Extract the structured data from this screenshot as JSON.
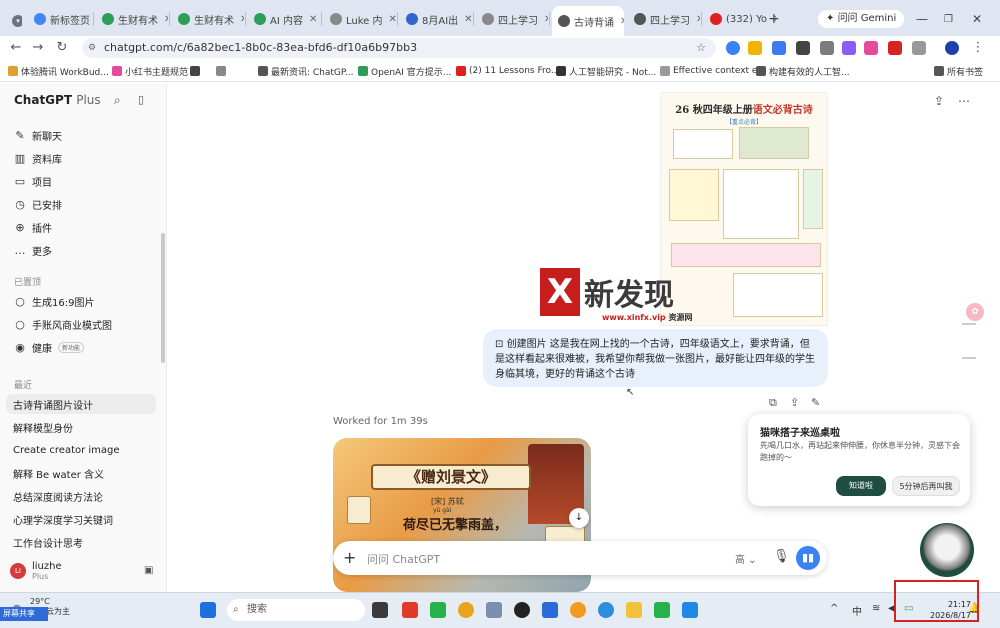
{
  "tabs": [
    {
      "label": "新标签页",
      "color": "#4285f4"
    },
    {
      "label": "生财有术",
      "color": "#2e9d5a"
    },
    {
      "label": "生财有术",
      "color": "#2e9d5a"
    },
    {
      "label": "AI 内容",
      "color": "#2e9d5a"
    },
    {
      "label": "Luke 内",
      "color": "#888888"
    },
    {
      "label": "8月AI出",
      "color": "#3366cc"
    },
    {
      "label": "四上学习",
      "color": "#888888"
    },
    {
      "label": "古诗背诵",
      "color": "#555555",
      "active": true
    },
    {
      "label": "四上学习",
      "color": "#555555"
    },
    {
      "label": "(332) Yo",
      "color": "#e02020"
    }
  ],
  "gemini_label": "问问 Gemini",
  "url": "chatgpt.com/c/6a82bec1-8b0c-83ea-bfd6-df10a6b97bb3",
  "bookmarks": [
    "体验腾讯 WorkBud...",
    "小红书主题规范",
    "",
    "",
    "最新资讯: ChatGP...",
    "OpenAI 官方提示...",
    "(2) 11 Lessons Fro...",
    "人工智能研究 - Not...",
    "Effective context e...",
    "构建有效的人工智...",
    "所有书签"
  ],
  "sidebar": {
    "app_title": "ChatGPT",
    "plan": "Plus",
    "primary": [
      {
        "icon": "✎",
        "label": "新聊天"
      },
      {
        "icon": "▥",
        "label": "资料库"
      },
      {
        "icon": "▭",
        "label": "项目"
      },
      {
        "icon": "◷",
        "label": "已安排"
      },
      {
        "icon": "⊕",
        "label": "插件"
      },
      {
        "icon": "…",
        "label": "更多"
      }
    ],
    "pinned_heading": "已置顶",
    "pinned": [
      {
        "label": "生成16:9图片",
        "badge": ""
      },
      {
        "label": "手账风商业模式图",
        "badge": ""
      },
      {
        "label": "健康",
        "badge": "新功能"
      }
    ],
    "recent_heading": "最近",
    "recent": [
      "古诗背诵图片设计",
      "解释模型身份",
      "Create creator image",
      "解释 Be water 含义",
      "总结深度阅读方法论",
      "心理学深度学习关键词",
      "工作台设计思考"
    ],
    "user_name": "liuzhe",
    "user_initials": "LI",
    "user_plan": "Plus"
  },
  "poster": {
    "title_prefix": "26 秋四年级上册",
    "title_highlight": "语文必背古诗",
    "subtitle": "【重点必背】"
  },
  "watermark": {
    "x": "X",
    "text": "新发现",
    "url": "www.xinfx.vip",
    "tag": "资源网"
  },
  "user_message": "创建图片  这是我在网上找的一个古诗，四年级语文上，要求背诵，但是这样看起来很难被，我希望你帮我做一张图片，最好能让四年级的学生身临其境，更好的背诵这个古诗",
  "worked_for": "Worked for 1m 39s",
  "generated": {
    "title": "《赠刘景文》",
    "author": "[宋] 苏轼",
    "line1": "荷尽已无擎雨盖，",
    "pinyin": "yǔ   gài"
  },
  "composer": {
    "placeholder": "问问 ChatGPT",
    "mode": "高"
  },
  "popup": {
    "title": "猫咪搭子来巡桌啦",
    "body": "先喝几口水，再站起来伸伸腰，你休息半分钟，灵感下会跑掉的～",
    "primary": "知道啦",
    "secondary": "5分钟后再叫我"
  },
  "taskbar": {
    "temp": "29°C",
    "weather": "以多云为主",
    "search": "搜索",
    "ime": "中",
    "time": "21:17",
    "date": "2026/8/17",
    "share": "屏幕共享"
  },
  "colors": {
    "accent": "#3b82f6",
    "popup_button": "#1f4d3f",
    "highlight_box": "#d62222"
  }
}
